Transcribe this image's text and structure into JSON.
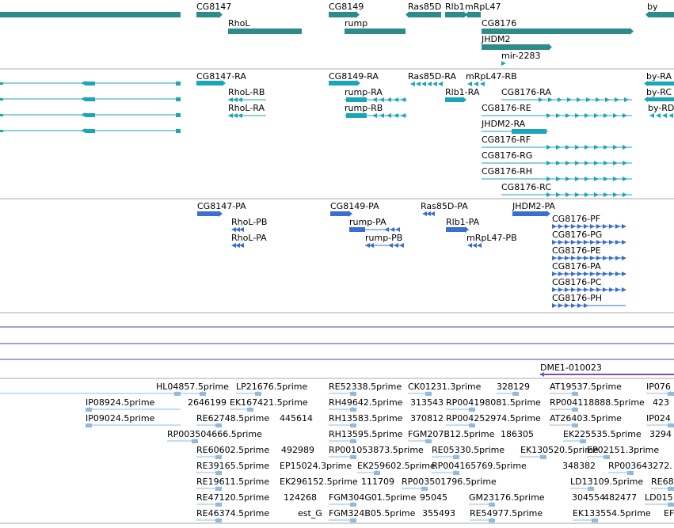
{
  "colors": {
    "gene": "#2e8b8b",
    "transcript": "#1aa5b8",
    "protein": "#3a6ed0",
    "divider": "#aaaaaa",
    "purple_line": "#5a3f8e",
    "cdna": "#8fbbe0",
    "dme1": "#7a4fb0"
  },
  "tracks": {
    "genes": [
      {
        "label": ""
      },
      {
        "label": "CG8147"
      },
      {
        "label": "RhoL"
      },
      {
        "label": "CG8149"
      },
      {
        "label": "rump"
      },
      {
        "label": "Ras85D"
      },
      {
        "label": "Rlb1"
      },
      {
        "label": "mRpL47"
      },
      {
        "label": "CG8176"
      },
      {
        "label": "JHDM2"
      },
      {
        "label": "mir-2283"
      },
      {
        "label": "by"
      }
    ],
    "transcripts": [
      {
        "label": ""
      },
      {
        "label": ""
      },
      {
        "label": ""
      },
      {
        "label": ""
      },
      {
        "label": "CG8147-RA"
      },
      {
        "label": "RhoL-RB"
      },
      {
        "label": "RhoL-RA"
      },
      {
        "label": "CG8149-RA"
      },
      {
        "label": "rump-RA"
      },
      {
        "label": "rump-RB"
      },
      {
        "label": "Ras85D-RA"
      },
      {
        "label": "Rlb1-RA"
      },
      {
        "label": "mRpL47-RB"
      },
      {
        "label": "CG8176-RA"
      },
      {
        "label": "CG8176-RE"
      },
      {
        "label": "JHDM2-RA"
      },
      {
        "label": "CG8176-RF"
      },
      {
        "label": "CG8176-RG"
      },
      {
        "label": "CG8176-RH"
      },
      {
        "label": "CG8176-RC"
      },
      {
        "label": "by-RA"
      },
      {
        "label": "by-RC"
      },
      {
        "label": "by-RD"
      }
    ],
    "proteins": [
      {
        "label": "CG8147-PA"
      },
      {
        "label": "RhoL-PB"
      },
      {
        "label": "RhoL-PA"
      },
      {
        "label": "CG8149-PA"
      },
      {
        "label": "rump-PA"
      },
      {
        "label": "rump-PB"
      },
      {
        "label": "Ras85D-PA"
      },
      {
        "label": "Rlb1-PA"
      },
      {
        "label": "mRpL47-PB"
      },
      {
        "label": "JHDM2-PA"
      },
      {
        "label": "CG8176-PF"
      },
      {
        "label": "CG8176-PG"
      },
      {
        "label": "CG8176-PE"
      },
      {
        "label": "CG8176-PA"
      },
      {
        "label": "CG8176-PC"
      },
      {
        "label": "CG8176-PH"
      }
    ],
    "dme1": {
      "label": "DME1-010023"
    },
    "cdna": [
      {
        "label": ""
      },
      {
        "label": "HL04857.5prime"
      },
      {
        "label": "LP21676.5prime"
      },
      {
        "label": "IP08924.5prime"
      },
      {
        "label": "2646199"
      },
      {
        "label": "EK167421.5prime"
      },
      {
        "label": "IP09024.5prime"
      },
      {
        "label": "RE62748.5prime"
      },
      {
        "label": "445614"
      },
      {
        "label": "RP003504666.5prime"
      },
      {
        "label": "RE60602.5prime"
      },
      {
        "label": "492989"
      },
      {
        "label": "RE39165.5prime"
      },
      {
        "label": "EP15024.3prime"
      },
      {
        "label": "RE19611.5prime"
      },
      {
        "label": "EK296152.5prime"
      },
      {
        "label": "RE47120.5prime"
      },
      {
        "label": "124268"
      },
      {
        "label": "RE46374.5prime"
      },
      {
        "label": "est_G"
      },
      {
        "label": "RE52338.5prime"
      },
      {
        "label": "CK01231.3prime"
      },
      {
        "label": "328129"
      },
      {
        "label": "RH49642.5prime"
      },
      {
        "label": "313543"
      },
      {
        "label": "RP004198081.5prime"
      },
      {
        "label": "RH13583.5prime"
      },
      {
        "label": "370812"
      },
      {
        "label": "RP004252974.5prime"
      },
      {
        "label": "RH13595.5prime"
      },
      {
        "label": "FGM207B12.5prime"
      },
      {
        "label": "186305"
      },
      {
        "label": "RP001053873.5prime"
      },
      {
        "label": "RE05330.5prime"
      },
      {
        "label": "EK259602.5prime"
      },
      {
        "label": "RP004165769.5prime"
      },
      {
        "label": "111709"
      },
      {
        "label": "RP003501796.5prime"
      },
      {
        "label": "FGM304G01.5prime"
      },
      {
        "label": "95045"
      },
      {
        "label": "GM23176.5prime"
      },
      {
        "label": "FGM324B05.5prime"
      },
      {
        "label": "355493"
      },
      {
        "label": "RE54977.5prime"
      },
      {
        "label": "AT19537.5prime"
      },
      {
        "label": "IP076"
      },
      {
        "label": "RP004118888.5prime"
      },
      {
        "label": "423"
      },
      {
        "label": "AT26403.5prime"
      },
      {
        "label": "IP024"
      },
      {
        "label": "EK225535.5prime"
      },
      {
        "label": "3294"
      },
      {
        "label": "EK130520.5prime"
      },
      {
        "label": "EP02151.3prime"
      },
      {
        "label": "348382"
      },
      {
        "label": "RP003643272."
      },
      {
        "label": "LD13109.5prime"
      },
      {
        "label": "RE68"
      },
      {
        "label": "304554"
      },
      {
        "label": "482477"
      },
      {
        "label": "LD015"
      },
      {
        "label": "EK133554.5prime"
      },
      {
        "label": "EF"
      }
    ]
  }
}
